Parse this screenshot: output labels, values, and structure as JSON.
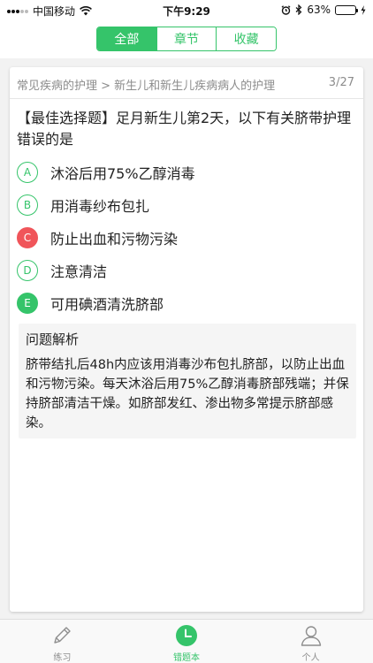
{
  "status_bar": {
    "carrier": "中国移动",
    "time": "下午9:29",
    "battery": "63%",
    "battery_level": 0.63
  },
  "header": {
    "segments": [
      {
        "label": "全部",
        "active": true
      },
      {
        "label": "章节",
        "active": false
      },
      {
        "label": "收藏",
        "active": false
      }
    ]
  },
  "card": {
    "breadcrumb": "常见疾病的护理 > 新生儿和新生儿疾病病人的护理",
    "counter": "3/27",
    "question": "【最佳选择题】足月新生儿第2天，以下有关脐带护理错误的是",
    "options": [
      {
        "letter": "A",
        "text": "沐浴后用75%乙醇消毒",
        "state": "normal"
      },
      {
        "letter": "B",
        "text": "用消毒纱布包扎",
        "state": "normal"
      },
      {
        "letter": "C",
        "text": "防止出血和污物污染",
        "state": "wrong"
      },
      {
        "letter": "D",
        "text": "注意清洁",
        "state": "normal"
      },
      {
        "letter": "E",
        "text": "可用碘酒清洗脐部",
        "state": "correct"
      }
    ],
    "analysis": {
      "title": "问题解析",
      "body": "脐带结扎后48h内应该用消毒沙布包扎脐部，以防止出血和污物污染。每天沐浴后用75%乙醇消毒脐部残端；并保持脐部清洁干燥。如脐部发红、渗出物多常提示脐部感染。"
    }
  },
  "tabbar": {
    "tabs": [
      {
        "label": "练习",
        "icon": "pencil-icon",
        "active": false
      },
      {
        "label": "错题本",
        "icon": "clock-icon",
        "active": true
      },
      {
        "label": "个人",
        "icon": "person-icon",
        "active": false
      }
    ]
  },
  "colors": {
    "accent": "#35c46a",
    "wrong": "#f0555a",
    "muted": "#8c8c8c"
  }
}
